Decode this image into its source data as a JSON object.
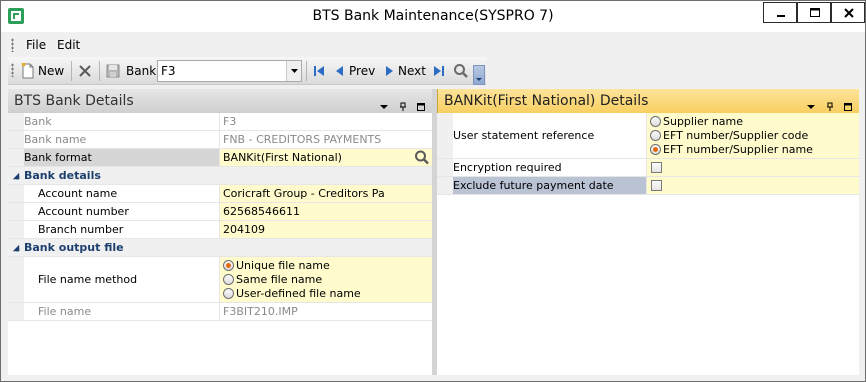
{
  "window": {
    "title": "BTS Bank Maintenance(SYSPRO 7)"
  },
  "menu": {
    "items": [
      {
        "label": "File"
      },
      {
        "label": "Edit"
      }
    ]
  },
  "toolbar": {
    "new_label": "New",
    "bank_label": "Bank:",
    "bank_value": "F3",
    "prev_label": "Prev",
    "next_label": "Next"
  },
  "left_pane": {
    "title": "BTS Bank Details",
    "rows": {
      "bank": {
        "label": "Bank",
        "value": "F3"
      },
      "bank_name": {
        "label": "Bank name",
        "value": "FNB - CREDITORS PAYMENTS"
      },
      "bank_format": {
        "label": "Bank format",
        "value": "BANKit(First National)"
      },
      "bank_details_cat": "Bank details",
      "account_name": {
        "label": "Account name",
        "value": "Coricraft Group - Creditors Pa"
      },
      "account_number": {
        "label": "Account number",
        "value": "62568546611"
      },
      "branch_number": {
        "label": "Branch number",
        "value": "204109"
      },
      "bank_output_cat": "Bank output file",
      "file_name_method": {
        "label": "File name method",
        "options": [
          "Unique file name",
          "Same file name",
          "User-defined file name"
        ],
        "selected": "Unique file name"
      },
      "file_name": {
        "label": "File name",
        "value": "F3BIT210.IMP"
      }
    }
  },
  "right_pane": {
    "title": "BANKit(First National) Details",
    "rows": {
      "user_statement_reference": {
        "label": "User statement reference",
        "options": [
          "Supplier name",
          "EFT number/Supplier code",
          "EFT number/Supplier name"
        ],
        "selected": "EFT number/Supplier name"
      },
      "encryption_required": {
        "label": "Encryption required",
        "checked": false
      },
      "exclude_future_payment_date": {
        "label": "Exclude future payment date",
        "checked": false
      }
    }
  },
  "colors": {
    "edit_background": "#fffbcc",
    "right_header": "#f8cf61",
    "category_text": "#1c3f6e",
    "radio_selected": "#e46b0e",
    "nav_blue": "#2c6cc4"
  }
}
